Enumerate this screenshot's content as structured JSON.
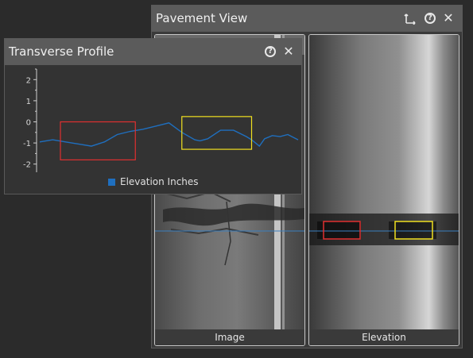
{
  "pavement_view": {
    "title": "Pavement View",
    "panels": [
      {
        "label": "Image"
      },
      {
        "label": "Elevation"
      }
    ]
  },
  "transverse_profile": {
    "title": "Transverse Profile",
    "legend": "Elevation Inches"
  },
  "icons": {
    "axes": "axes-move-icon",
    "help": "help-icon",
    "close": "close-icon"
  },
  "colors": {
    "series": "#1f6fbf",
    "red_box": "#e03030",
    "yellow_box": "#f0e020",
    "scan_line": "#3a7fbf"
  },
  "chart_data": {
    "type": "line",
    "series": [
      {
        "name": "Elevation Inches",
        "x": [
          0,
          0.05,
          0.1,
          0.15,
          0.2,
          0.25,
          0.3,
          0.35,
          0.4,
          0.45,
          0.5,
          0.55,
          0.6,
          0.62,
          0.65,
          0.7,
          0.75,
          0.8,
          0.82,
          0.85,
          0.87,
          0.9,
          0.93,
          0.96,
          1.0
        ],
        "values": [
          -0.95,
          -0.85,
          -0.95,
          -1.05,
          -1.15,
          -0.95,
          -0.6,
          -0.45,
          -0.35,
          -0.2,
          -0.05,
          -0.5,
          -0.85,
          -0.9,
          -0.8,
          -0.4,
          -0.4,
          -0.7,
          -0.85,
          -1.15,
          -0.8,
          -0.65,
          -0.7,
          -0.6,
          -0.85
        ]
      }
    ],
    "yticks": [
      "2",
      "1",
      "0",
      "-1",
      "-2"
    ],
    "ylim": [
      -2.5,
      2.5
    ],
    "grid": false,
    "legend_position": "bottom-center",
    "annotations": [
      {
        "kind": "box",
        "color": "red",
        "x_range": [
          0.08,
          0.37
        ],
        "y_range": [
          -1.8,
          0.0
        ]
      },
      {
        "kind": "box",
        "color": "yellow",
        "x_range": [
          0.55,
          0.82
        ],
        "y_range": [
          -1.3,
          0.25
        ]
      }
    ]
  }
}
